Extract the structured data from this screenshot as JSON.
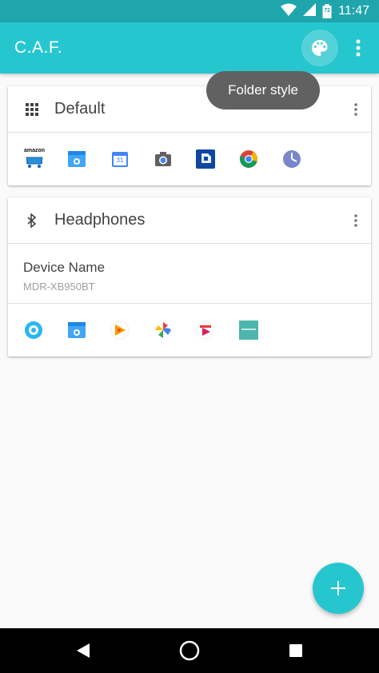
{
  "status_bar": {
    "time": "11:47",
    "battery_level": "72"
  },
  "app_bar": {
    "title": "C.A.F.",
    "palette_icon": "palette-icon",
    "overflow_icon": "more-vert-icon"
  },
  "tooltip": {
    "text": "Folder style"
  },
  "folders": [
    {
      "title": "Default",
      "icon": "apps-grid-icon",
      "apps": [
        "amazon-shopping-icon",
        "tasks-app-icon",
        "calendar-icon",
        "camera-icon",
        "chase-bank-icon",
        "chrome-icon",
        "clock-icon"
      ],
      "calendar_day": "31"
    },
    {
      "title": "Headphones",
      "icon": "bluetooth-icon",
      "device_label": "Device Name",
      "device_value": "MDR-XB950BT",
      "apps": [
        "flower-app-icon",
        "tasks-app-icon",
        "play-music-icon",
        "photos-pinwheel-icon",
        "play-movies-icon",
        "teal-app-icon"
      ],
      "amazon_label": "amazon"
    }
  ],
  "fab": {
    "icon": "add-icon"
  },
  "nav": {
    "back": "back-icon",
    "home": "home-icon",
    "recents": "recents-icon"
  },
  "colors": {
    "primary": "#26c6cf",
    "primary_dark": "#1fa6ad",
    "tooltip": "#616161"
  }
}
